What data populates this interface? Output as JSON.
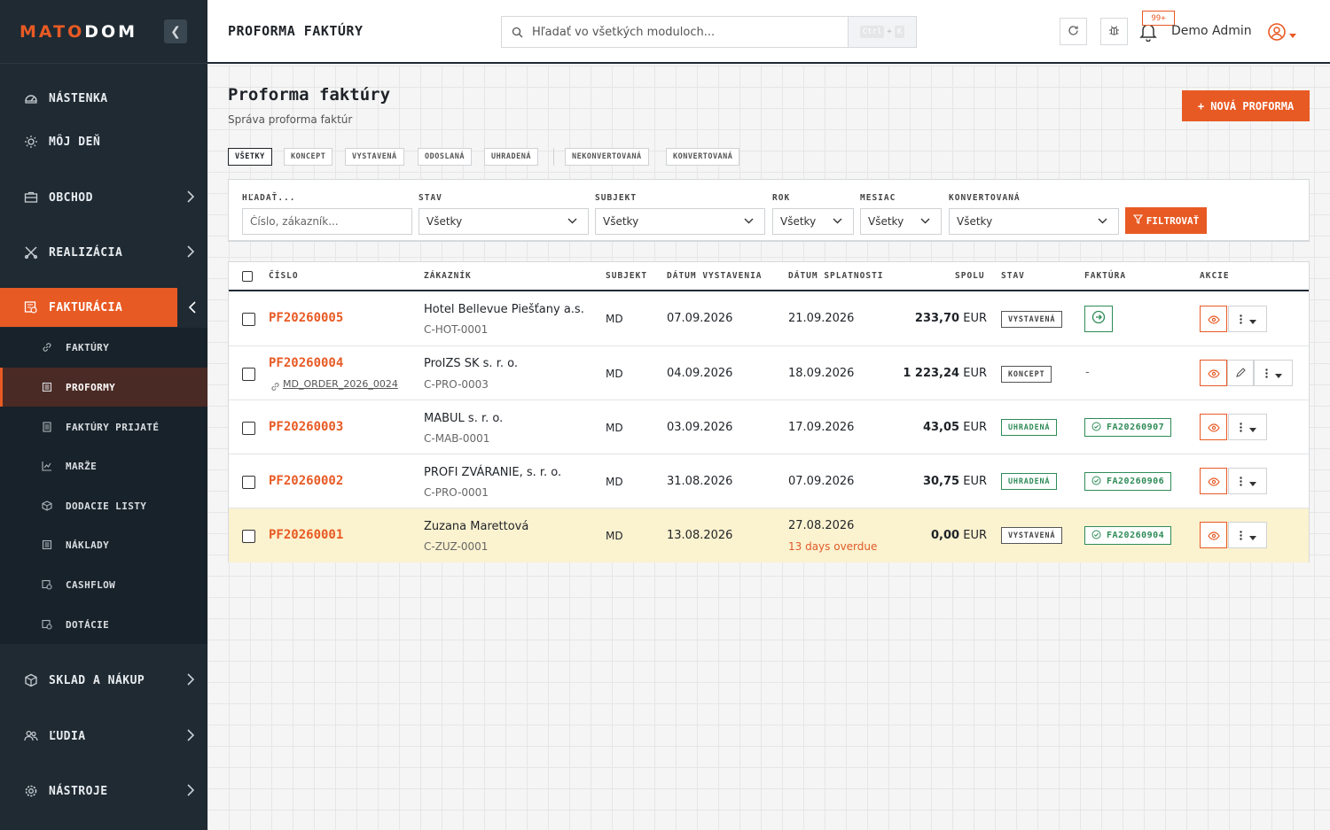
{
  "brand": {
    "part1": "MATO",
    "part2": "DOM"
  },
  "sidebar": {
    "items": [
      {
        "label": "NÁSTENKA",
        "icon": "gauge-icon"
      },
      {
        "label": "MÔJ DEŇ",
        "icon": "sun-icon"
      },
      {
        "label": "OBCHOD",
        "icon": "briefcase-icon"
      },
      {
        "label": "REALIZÁCIA",
        "icon": "tools-icon"
      },
      {
        "label": "FAKTURÁCIA",
        "icon": "invoice-icon"
      },
      {
        "label": "SKLAD A NÁKUP",
        "icon": "box-icon"
      },
      {
        "label": "ĽUDIA",
        "icon": "people-icon"
      },
      {
        "label": "NÁSTROJE",
        "icon": "gear-icon"
      }
    ],
    "sub_items": [
      {
        "label": "FAKTÚRY",
        "icon": "link-icon"
      },
      {
        "label": "PROFORMY",
        "icon": "document-icon"
      },
      {
        "label": "FAKTÚRY PRIJATÉ",
        "icon": "document-icon"
      },
      {
        "label": "MARŽE",
        "icon": "chart-icon"
      },
      {
        "label": "DODACIE LISTY",
        "icon": "package-icon"
      },
      {
        "label": "NÁKLADY",
        "icon": "document-icon"
      },
      {
        "label": "CASHFLOW",
        "icon": "money-icon"
      },
      {
        "label": "DOTÁCIE",
        "icon": "money-icon"
      }
    ]
  },
  "header": {
    "title": "PROFORMA FAKTÚRY",
    "search_placeholder": "Hľadať vo všetkých moduloch...",
    "shortcut": {
      "key1": "Ctrl",
      "plus": "+",
      "key2": "K"
    },
    "notifications_badge": "99+",
    "user_name": "Demo Admin"
  },
  "page": {
    "title": "Proforma faktúry",
    "subtitle": "Správa proforma faktúr",
    "new_button": "+ NOVÁ PROFORMA"
  },
  "chips": [
    "VŠETKY",
    "KONCEPT",
    "VYSTAVENÁ",
    "ODOSLANÁ",
    "UHRADENÁ",
    "NEKONVERTOVANÁ",
    "KONVERTOVANÁ"
  ],
  "filters": {
    "search_label": "HĽADAŤ...",
    "search_placeholder": "Číslo, zákazník...",
    "stav_label": "STAV",
    "stav_value": "Všetky",
    "subjekt_label": "SUBJEKT",
    "subjekt_value": "Všetky",
    "rok_label": "ROK",
    "rok_value": "Všetky",
    "mesiac_label": "MESIAC",
    "mesiac_value": "Všetky",
    "konv_label": "KONVERTOVANÁ",
    "konv_value": "Všetky",
    "button": "FILTROVAŤ"
  },
  "table": {
    "headers": {
      "cislo": "ČÍSLO",
      "zakaznik": "ZÁKAZNÍK",
      "subjekt": "SUBJEKT",
      "vystavenie": "DÁTUM VYSTAVENIA",
      "splatnost": "DÁTUM SPLATNOSTI",
      "spolu": "SPOLU",
      "stav": "STAV",
      "faktura": "FAKTÚRA",
      "akcie": "AKCIE"
    },
    "rows": [
      {
        "number": "PF20260005",
        "ref": "",
        "customer": "Hotel Bellevue Piešťany a.s.",
        "code": "C-HOT-0001",
        "subject": "MD",
        "issued": "07.09.2026",
        "due": "21.09.2026",
        "due_note": "",
        "amount": "233,70",
        "currency": "EUR",
        "status": "VYSTAVENÁ",
        "invoice": ""
      },
      {
        "number": "PF20260004",
        "ref": "MD_ORDER_2026_0024",
        "customer": "ProIZS SK s. r. o.",
        "code": "C-PRO-0003",
        "subject": "MD",
        "issued": "04.09.2026",
        "due": "18.09.2026",
        "due_note": "",
        "amount": "1 223,24",
        "currency": "EUR",
        "status": "KONCEPT",
        "invoice": "-"
      },
      {
        "number": "PF20260003",
        "ref": "",
        "customer": "MABUL s. r. o.",
        "code": "C-MAB-0001",
        "subject": "MD",
        "issued": "03.09.2026",
        "due": "17.09.2026",
        "due_note": "",
        "amount": "43,05",
        "currency": "EUR",
        "status": "UHRADENÁ",
        "invoice": "FA20260907"
      },
      {
        "number": "PF20260002",
        "ref": "",
        "customer": "PROFI ZVÁRANIE, s. r. o.",
        "code": "C-PRO-0001",
        "subject": "MD",
        "issued": "31.08.2026",
        "due": "07.09.2026",
        "due_note": "",
        "amount": "30,75",
        "currency": "EUR",
        "status": "UHRADENÁ",
        "invoice": "FA20260906"
      },
      {
        "number": "PF20260001",
        "ref": "",
        "customer": "Zuzana Marettová",
        "code": "C-ZUZ-0001",
        "subject": "MD",
        "issued": "13.08.2026",
        "due": "27.08.2026",
        "due_note": "13 days overdue",
        "amount": "0,00",
        "currency": "EUR",
        "status": "VYSTAVENÁ",
        "invoice": "FA20260904"
      }
    ]
  },
  "colors": {
    "accent": "#e85a24",
    "sidebar": "#1f2a33",
    "paid": "#2e8b57",
    "overdue_row": "#fbf2cf"
  }
}
